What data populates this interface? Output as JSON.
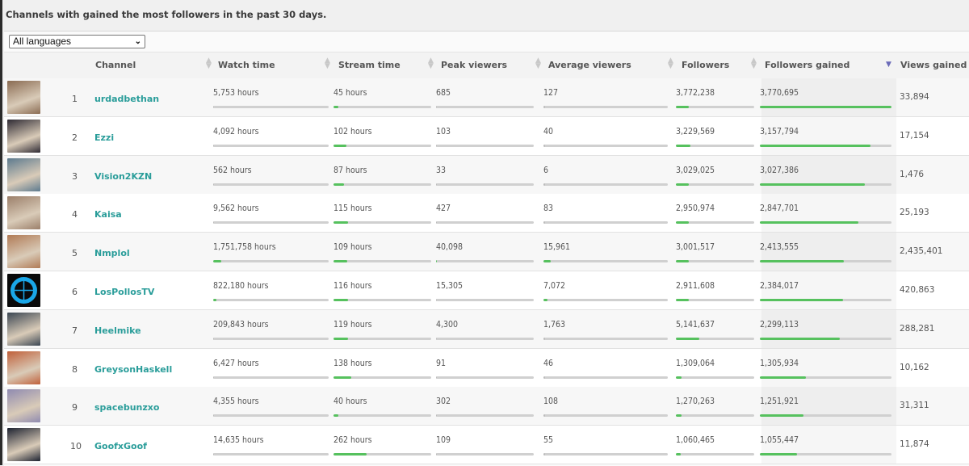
{
  "title": "Channels with gained the most followers in the past 30 days.",
  "language_filter": {
    "selected": "All languages"
  },
  "columns": [
    {
      "key": "channel",
      "label": "Channel"
    },
    {
      "key": "watch_time",
      "label": "Watch time"
    },
    {
      "key": "stream_time",
      "label": "Stream time"
    },
    {
      "key": "peak_viewers",
      "label": "Peak viewers"
    },
    {
      "key": "average_viewers",
      "label": "Average viewers"
    },
    {
      "key": "followers",
      "label": "Followers"
    },
    {
      "key": "followers_gained",
      "label": "Followers gained"
    },
    {
      "key": "views_gained",
      "label": "Views gained"
    }
  ],
  "sorted_by": "followers_gained",
  "colors": {
    "channel_link": "#2a9d9a",
    "bar_fill": "#56c15e",
    "bar_track": "#d0d0d0",
    "sort_active": "#6a6ab8"
  },
  "rows": [
    {
      "rank": "1",
      "channel": "urdadbethan",
      "watch_time": "5,753 hours",
      "watch_pct": 0,
      "stream_time": "45 hours",
      "stream_pct": 5,
      "peak": "685",
      "peak_pct": 0,
      "avg": "127",
      "avg_pct": 0,
      "followers": "3,772,238",
      "followers_pct": 17,
      "followers_gained": "3,770,695",
      "gained_pct": 100,
      "views_gained": "33,894",
      "avatar_color": "#8a6b52"
    },
    {
      "rank": "2",
      "channel": "Ezzi",
      "watch_time": "4,092 hours",
      "watch_pct": 0,
      "stream_time": "102 hours",
      "stream_pct": 13,
      "peak": "103",
      "peak_pct": 0,
      "avg": "40",
      "avg_pct": 0,
      "followers": "3,229,569",
      "followers_pct": 19,
      "followers_gained": "3,157,794",
      "gained_pct": 84,
      "views_gained": "17,154",
      "avatar_color": "#2e2a33"
    },
    {
      "rank": "3",
      "channel": "Vision2KZN",
      "watch_time": "562 hours",
      "watch_pct": 0,
      "stream_time": "87 hours",
      "stream_pct": 11,
      "peak": "33",
      "peak_pct": 0,
      "avg": "6",
      "avg_pct": 0,
      "followers": "3,029,025",
      "followers_pct": 17,
      "followers_gained": "3,027,386",
      "gained_pct": 80,
      "views_gained": "1,476",
      "avatar_color": "#5c7a8e"
    },
    {
      "rank": "4",
      "channel": "Kaisa",
      "watch_time": "9,562 hours",
      "watch_pct": 0,
      "stream_time": "115 hours",
      "stream_pct": 15,
      "peak": "427",
      "peak_pct": 0,
      "avg": "83",
      "avg_pct": 0,
      "followers": "2,950,974",
      "followers_pct": 17,
      "followers_gained": "2,847,701",
      "gained_pct": 75,
      "views_gained": "25,193",
      "avatar_color": "#9b7f6a"
    },
    {
      "rank": "5",
      "channel": "Nmplol",
      "watch_time": "1,751,758 hours",
      "watch_pct": 7,
      "stream_time": "109 hours",
      "stream_pct": 14,
      "peak": "40,098",
      "peak_pct": 1,
      "avg": "15,961",
      "avg_pct": 6,
      "followers": "3,001,517",
      "followers_pct": 17,
      "followers_gained": "2,413,555",
      "gained_pct": 64,
      "views_gained": "2,435,401",
      "avatar_color": "#b07a55"
    },
    {
      "rank": "6",
      "channel": "LosPollosTV",
      "watch_time": "822,180 hours",
      "watch_pct": 3,
      "stream_time": "116 hours",
      "stream_pct": 15,
      "peak": "15,305",
      "peak_pct": 0,
      "avg": "7,072",
      "avg_pct": 3,
      "followers": "2,911,608",
      "followers_pct": 17,
      "followers_gained": "2,384,017",
      "gained_pct": 63,
      "views_gained": "420,863",
      "avatar_color": "#0a0a0a"
    },
    {
      "rank": "7",
      "channel": "Heelmike",
      "watch_time": "209,843 hours",
      "watch_pct": 0,
      "stream_time": "119 hours",
      "stream_pct": 15,
      "peak": "4,300",
      "peak_pct": 0,
      "avg": "1,763",
      "avg_pct": 0,
      "followers": "5,141,637",
      "followers_pct": 30,
      "followers_gained": "2,299,113",
      "gained_pct": 61,
      "views_gained": "288,281",
      "avatar_color": "#3b4652"
    },
    {
      "rank": "8",
      "channel": "GreysonHaskell",
      "watch_time": "6,427 hours",
      "watch_pct": 0,
      "stream_time": "138 hours",
      "stream_pct": 18,
      "peak": "91",
      "peak_pct": 0,
      "avg": "46",
      "avg_pct": 0,
      "followers": "1,309,064",
      "followers_pct": 7,
      "followers_gained": "1,305,934",
      "gained_pct": 35,
      "views_gained": "10,162",
      "avatar_color": "#c0603a"
    },
    {
      "rank": "9",
      "channel": "spacebunzxo",
      "watch_time": "4,355 hours",
      "watch_pct": 0,
      "stream_time": "40 hours",
      "stream_pct": 5,
      "peak": "302",
      "peak_pct": 0,
      "avg": "108",
      "avg_pct": 0,
      "followers": "1,270,263",
      "followers_pct": 7,
      "followers_gained": "1,251,921",
      "gained_pct": 33,
      "views_gained": "31,311",
      "avatar_color": "#8f8ab0"
    },
    {
      "rank": "10",
      "channel": "GoofxGoof",
      "watch_time": "14,635 hours",
      "watch_pct": 0,
      "stream_time": "262 hours",
      "stream_pct": 34,
      "peak": "109",
      "peak_pct": 0,
      "avg": "55",
      "avg_pct": 0,
      "followers": "1,060,465",
      "followers_pct": 6,
      "followers_gained": "1,055,447",
      "gained_pct": 28,
      "views_gained": "11,874",
      "avatar_color": "#1d2230"
    }
  ]
}
